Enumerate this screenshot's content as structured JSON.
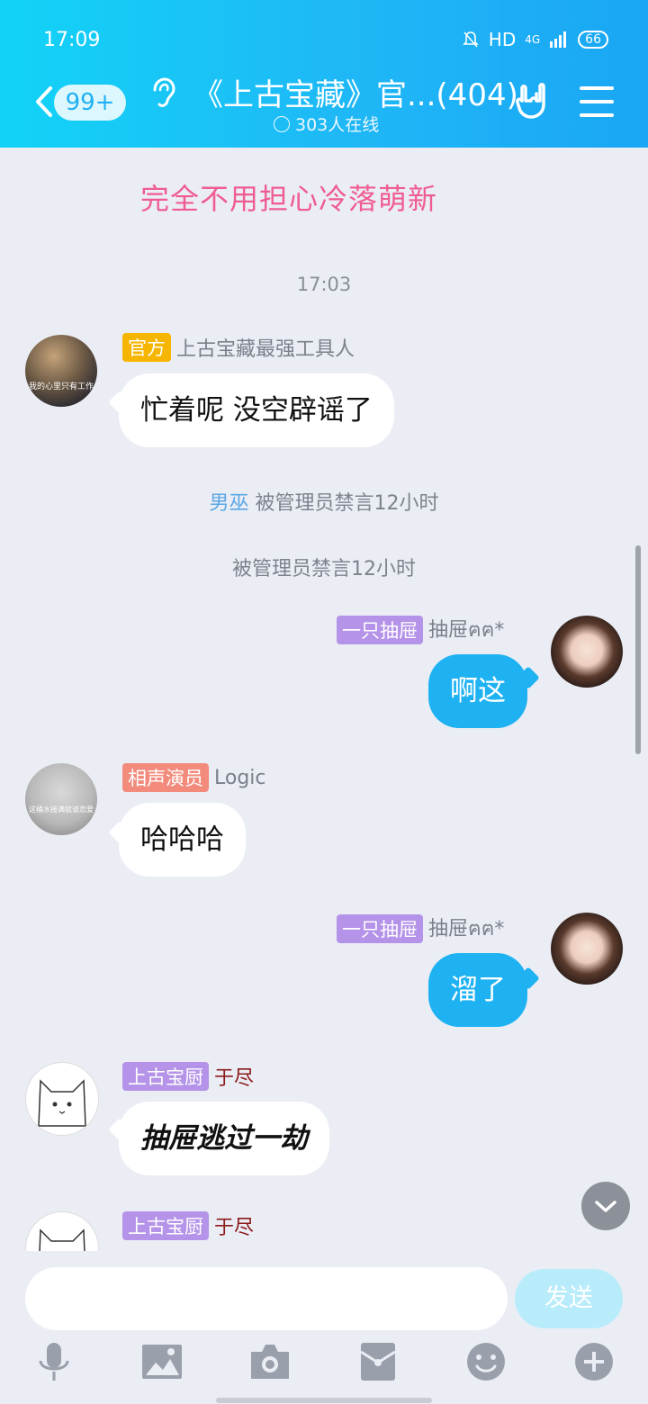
{
  "status_bar": {
    "time": "17:09",
    "network": "HD",
    "signal": "4G",
    "battery": "66"
  },
  "header": {
    "unread_badge": "99+",
    "title": "《上古宝藏》官...(404)",
    "online_count": "303人在线"
  },
  "banner": "完全不用担心冷落萌新",
  "messages": {
    "ts1": "17:03",
    "m1": {
      "tag": "官方",
      "name": "上古宝藏最强工具人",
      "text": "忙着呢 没空辟谣了",
      "avatar_caption": "我的心里只有工作"
    },
    "sys1": {
      "user": "男巫",
      "text": " 被管理员禁言12小时"
    },
    "sys2": {
      "text": "被管理员禁言12小时"
    },
    "m2": {
      "tag": "一只抽屉",
      "name": "抽屉ฅฅ*",
      "text": "啊这"
    },
    "m3": {
      "tag": "相声演员",
      "name": "Logic",
      "text": "哈哈哈",
      "avatar_caption": "这桶水接满就谈恋爱"
    },
    "m4": {
      "tag": "一只抽屉",
      "name": "抽屉ฅฅ*",
      "text": "溜了"
    },
    "m5": {
      "tag": "上古宝厨",
      "name": "于尽",
      "text": "抽屉逃过一劫"
    },
    "m6": {
      "tag": "上古宝厨",
      "name": "于尽"
    }
  },
  "input": {
    "placeholder": "",
    "send_label": "发送"
  },
  "toolbar": [
    "microphone-icon",
    "image-icon",
    "camera-icon",
    "red-packet-icon",
    "emoji-icon",
    "plus-icon"
  ],
  "colors": {
    "header": "#1fb7f6",
    "my_bubble": "#1fb2f2",
    "tag_official": "#f5b500",
    "tag_purple": "#b493e8",
    "tag_red": "#f28b7c"
  }
}
